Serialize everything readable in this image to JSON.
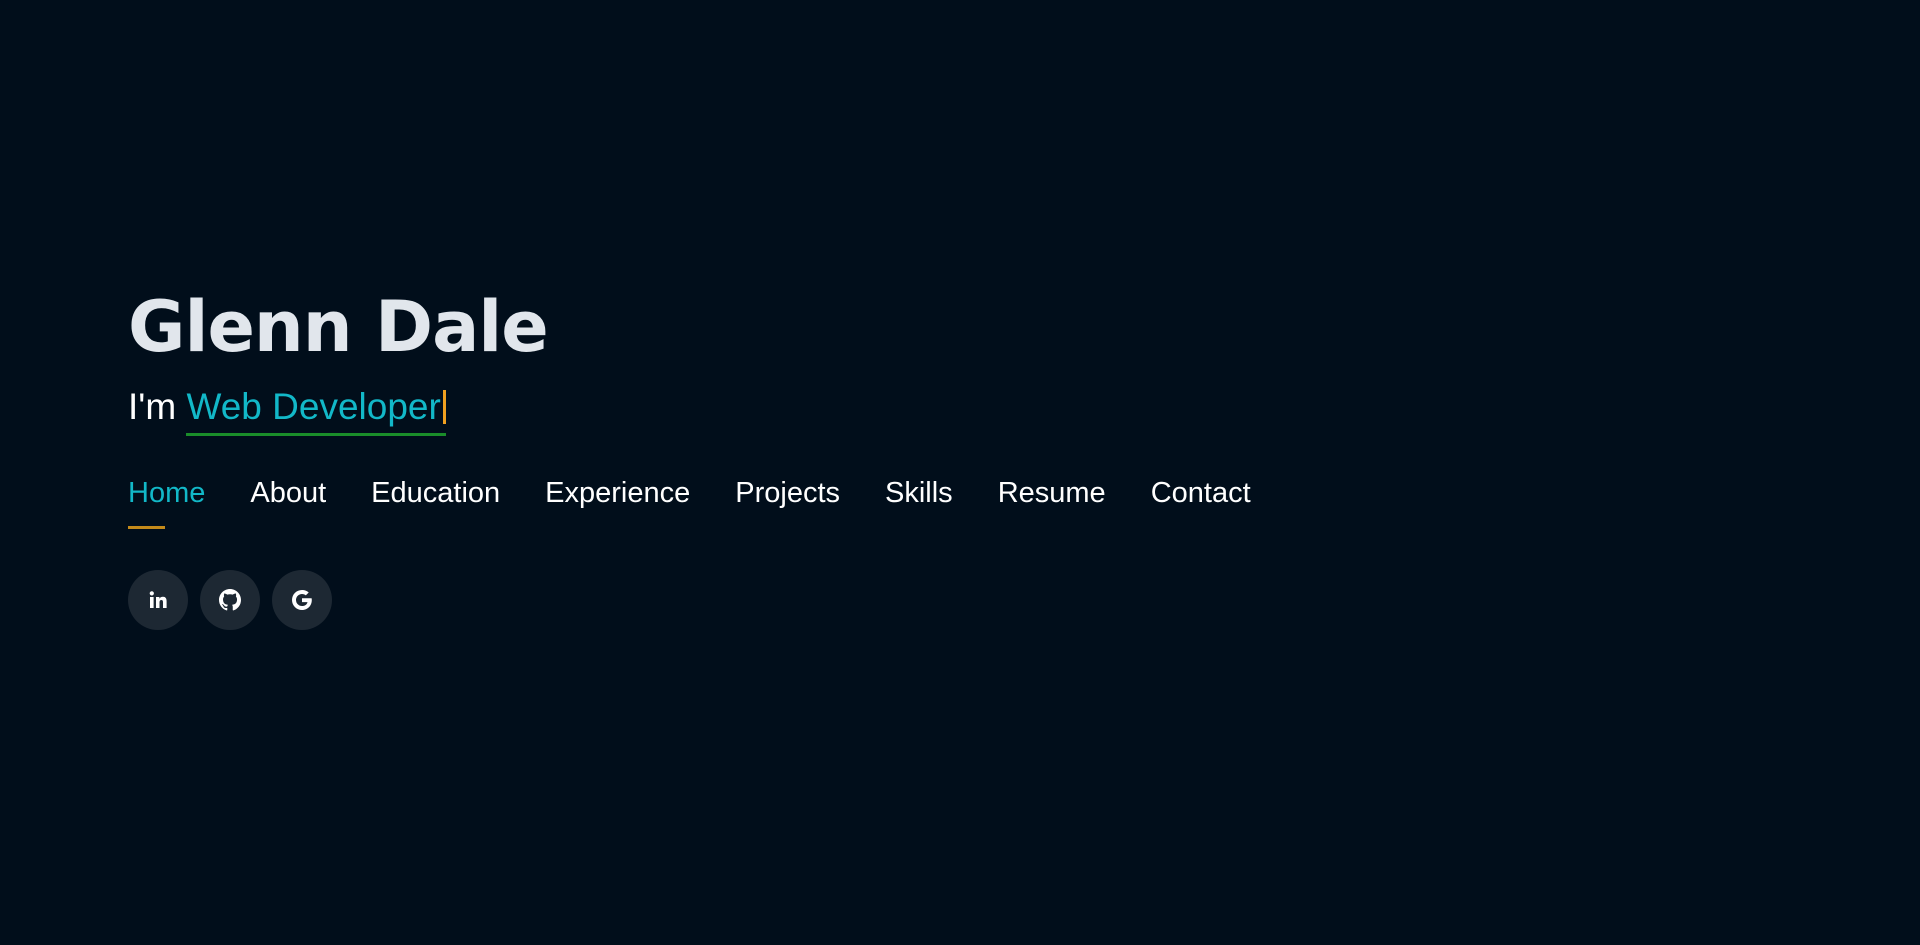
{
  "hero": {
    "name": "Glenn Dale",
    "tagline_prefix": "I'm ",
    "tagline_role": "Web Developer"
  },
  "nav": {
    "items": [
      {
        "label": "Home",
        "active": true
      },
      {
        "label": "About",
        "active": false
      },
      {
        "label": "Education",
        "active": false
      },
      {
        "label": "Experience",
        "active": false
      },
      {
        "label": "Projects",
        "active": false
      },
      {
        "label": "Skills",
        "active": false
      },
      {
        "label": "Resume",
        "active": false
      },
      {
        "label": "Contact",
        "active": false
      }
    ]
  },
  "socials": [
    {
      "icon": "linkedin-icon"
    },
    {
      "icon": "github-icon"
    },
    {
      "icon": "google-icon"
    }
  ],
  "colors": {
    "background": "#010e1b",
    "accent": "#12b8c8",
    "underline_green": "#1a8d2a",
    "nav_underline": "#c48a1a",
    "cursor": "#f0a020",
    "social_bg": "#1d2833"
  }
}
